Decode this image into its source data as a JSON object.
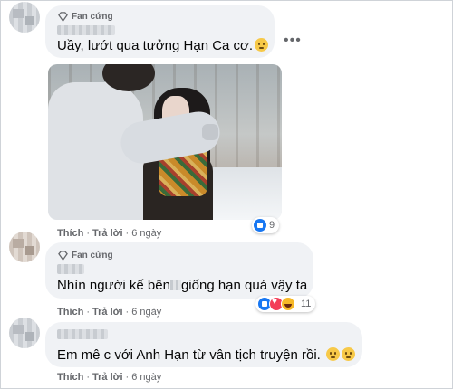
{
  "comments": [
    {
      "badge": "Fan cứng",
      "text": "Uầy, lướt qua tưởng Hạn Ca cơ.",
      "emoji": "flushed-face",
      "actions": {
        "like": "Thích",
        "reply": "Trả lời",
        "time": "6 ngày"
      },
      "reactions": {
        "count": "9",
        "types": [
          "like"
        ]
      }
    },
    {
      "badge": "Fan cứng",
      "text_before": "Nhìn người kế bên",
      "text_after": "giống hạn quá vậy ta",
      "actions": {
        "like": "Thích",
        "reply": "Trả lời",
        "time": "6 ngày"
      },
      "reactions": {
        "count": "11",
        "types": [
          "like",
          "love",
          "haha"
        ]
      }
    },
    {
      "text": "Em mê c với Anh Hạn từ vân tịch truyện rồi.",
      "emojis": [
        "flushed-face",
        "flushed-face"
      ],
      "actions": {
        "like": "Thích",
        "reply": "Trả lời",
        "time": "6 ngày"
      }
    }
  ],
  "more_menu": "•••",
  "colors": {
    "bubble": "#f0f2f5",
    "meta": "#65676b",
    "like": "#1877f2",
    "love": "#f33e58",
    "haha": "#f7b928"
  }
}
